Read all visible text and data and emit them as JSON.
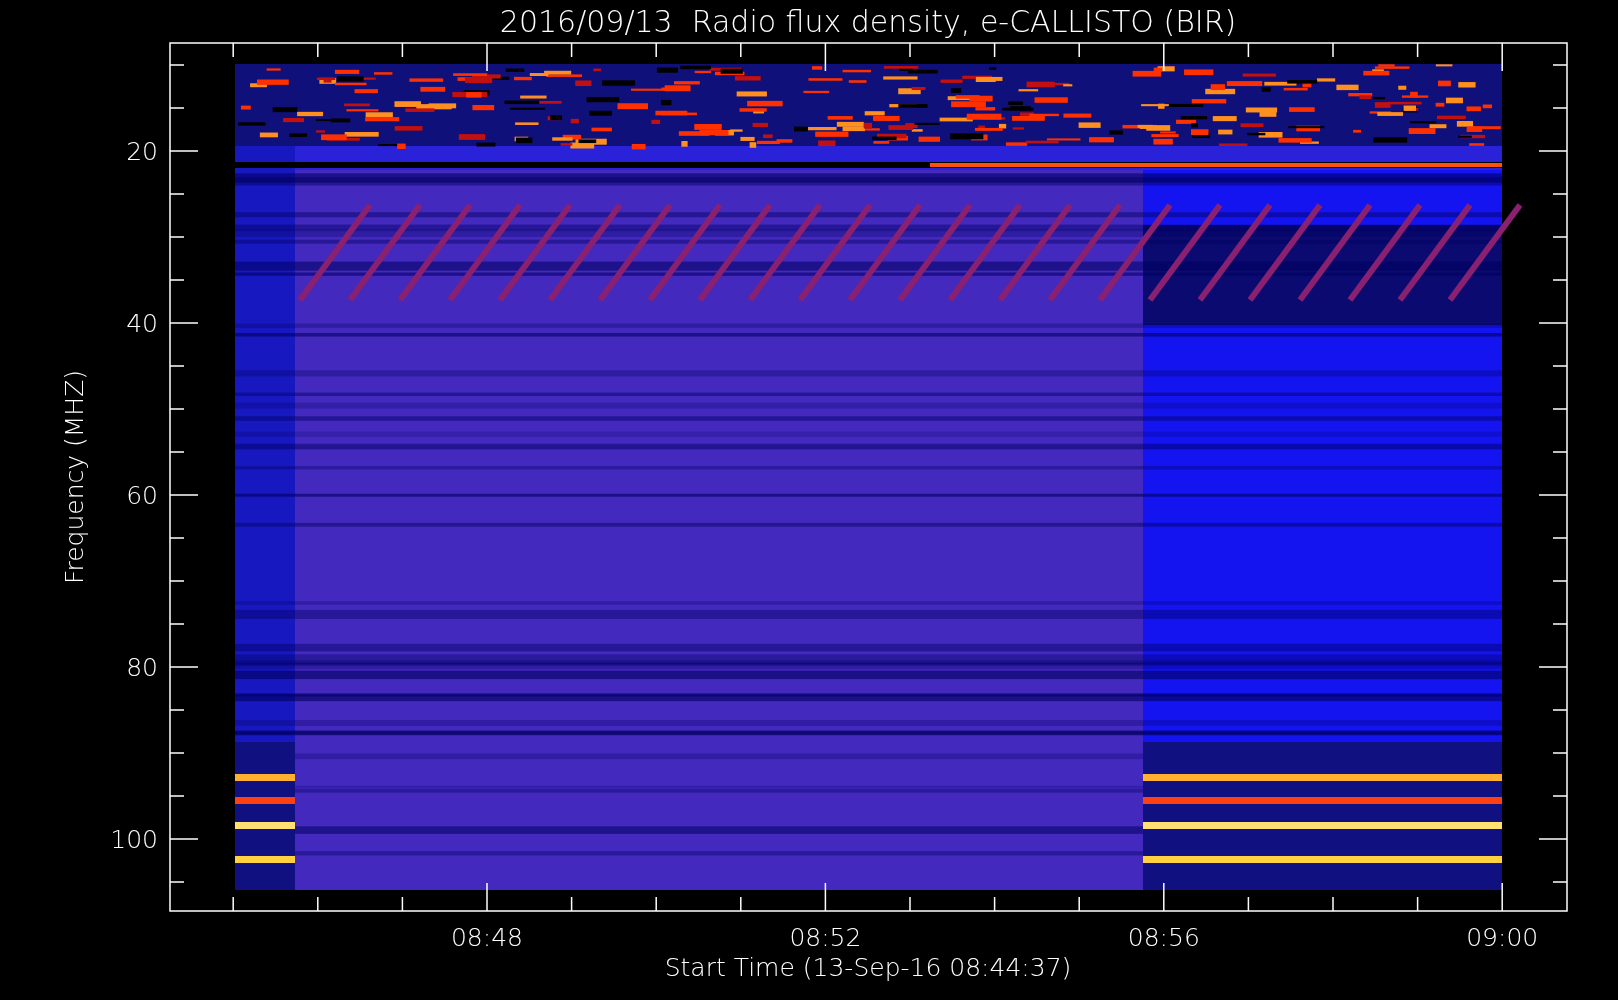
{
  "plot": {
    "title": "2016/09/13  Radio flux density, e-CALLISTO (BIR)",
    "ylabel": "Frequency (MHZ)",
    "xlabel": "Start Time (13-Sep-16 08:44:37)",
    "y_tick_labels": [
      "20",
      "40",
      "60",
      "80",
      "100"
    ],
    "x_tick_labels": [
      "08:48",
      "08:52",
      "08:56",
      "09:00"
    ]
  }
}
